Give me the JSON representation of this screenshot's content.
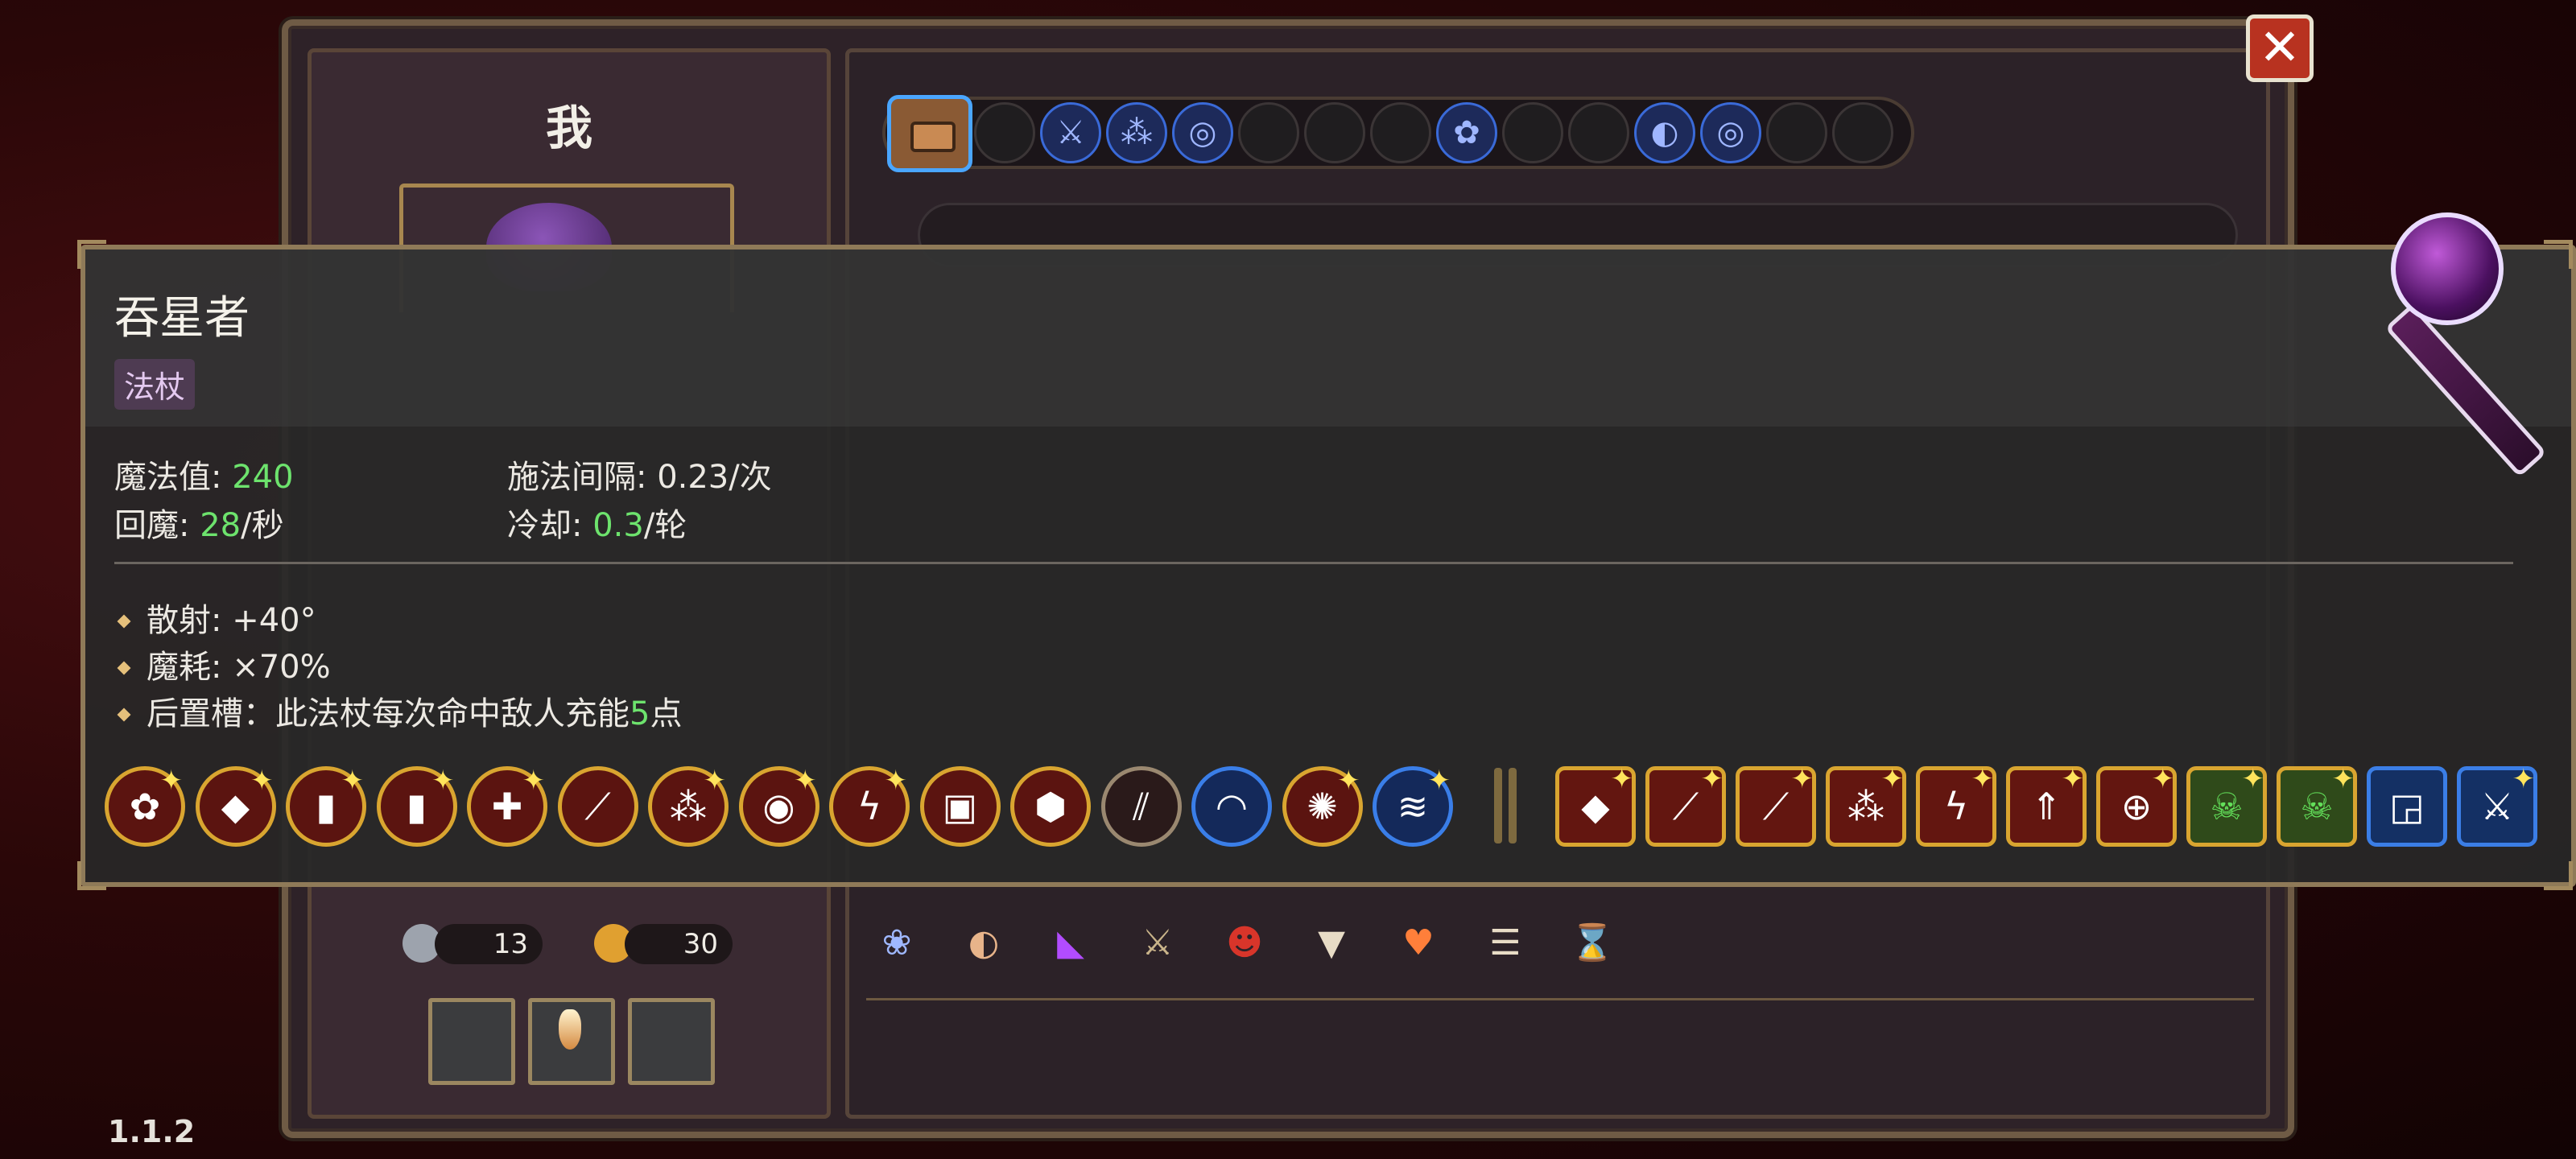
{
  "player": {
    "name": "我"
  },
  "close": {
    "glyph": "✕"
  },
  "inventory": {
    "keys": "13",
    "coins": "30"
  },
  "version": "1.1.2",
  "tooltip": {
    "title": "吞星者",
    "tag": "法杖",
    "stats": {
      "mana_label": "魔法值: ",
      "mana_value": "240",
      "recharge_label": "回魔: ",
      "recharge_value": "28",
      "recharge_unit": "/秒",
      "cast_delay_label": "施法间隔: 0.23/次",
      "cooldown_label": "冷却: ",
      "cooldown_value": "0.3",
      "cooldown_unit": "/轮"
    },
    "properties": {
      "spread": "散射: +40°",
      "mana_cost": "魔耗: ×70%",
      "post_slot_prefix": "后置槽：此法杖每次命中敌人充能",
      "post_slot_value": "5",
      "post_slot_suffix": "点"
    }
  },
  "spells": {
    "round": [
      {
        "icon": "flower-burst-icon",
        "glyph": "✿",
        "spark": true
      },
      {
        "icon": "rock-icon",
        "glyph": "◆",
        "spark": true
      },
      {
        "icon": "battery-icon",
        "glyph": "▮",
        "spark": true
      },
      {
        "icon": "battery-icon",
        "glyph": "▮",
        "spark": true
      },
      {
        "icon": "cross-burst-icon",
        "glyph": "✚",
        "spark": true
      },
      {
        "icon": "claw-icon",
        "glyph": "⟋",
        "spark": false
      },
      {
        "icon": "triple-shot-icon",
        "glyph": "⁂",
        "spark": true
      },
      {
        "icon": "eye-target-icon",
        "glyph": "◉",
        "spark": true
      },
      {
        "icon": "lightning-icon",
        "glyph": "ϟ",
        "spark": true
      },
      {
        "icon": "box-icon",
        "glyph": "▣",
        "spark": false
      },
      {
        "icon": "crystal-icon",
        "glyph": "⬢",
        "spark": false
      },
      {
        "icon": "slash-icon",
        "glyph": "⫽",
        "spark": false
      },
      {
        "icon": "rainbow-icon",
        "glyph": "◠",
        "spark": false
      },
      {
        "icon": "starburst-icon",
        "glyph": "✺",
        "spark": true
      },
      {
        "icon": "storm-icon",
        "glyph": "≋",
        "spark": true
      }
    ],
    "square": [
      {
        "icon": "rock-icon",
        "glyph": "◆",
        "spark": true,
        "style": ""
      },
      {
        "icon": "claw-icon",
        "glyph": "⟋",
        "spark": true,
        "style": ""
      },
      {
        "icon": "claw-icon",
        "glyph": "⟋",
        "spark": true,
        "style": ""
      },
      {
        "icon": "triple-shot-icon",
        "glyph": "⁂",
        "spark": true,
        "style": ""
      },
      {
        "icon": "lightning-icon",
        "glyph": "ϟ",
        "spark": true,
        "style": ""
      },
      {
        "icon": "arrow-up-icon",
        "glyph": "⇑",
        "spark": true,
        "style": ""
      },
      {
        "icon": "crosshair-icon",
        "glyph": "⊕",
        "spark": true,
        "style": ""
      },
      {
        "icon": "skull-icon",
        "glyph": "☠",
        "spark": true,
        "style": "green"
      },
      {
        "icon": "skull-icon",
        "glyph": "☠",
        "spark": true,
        "style": "green"
      },
      {
        "icon": "spiral-icon",
        "glyph": "◲",
        "spark": false,
        "style": "blue"
      },
      {
        "icon": "swords-icon",
        "glyph": "⚔",
        "spark": true,
        "style": "blue"
      }
    ]
  },
  "relics": [
    {
      "icon": "lotus-icon",
      "glyph": "❀",
      "color": "#9fb8ff"
    },
    {
      "icon": "ear-icon",
      "glyph": "◐",
      "color": "#e8b48a"
    },
    {
      "icon": "cape-icon",
      "glyph": "◣",
      "color": "#b24cff"
    },
    {
      "icon": "sword-icon",
      "glyph": "⚔",
      "color": "#c9b48a"
    },
    {
      "icon": "demon-mask-icon",
      "glyph": "☻",
      "color": "#d8352a"
    },
    {
      "icon": "fangs-icon",
      "glyph": "▼",
      "color": "#e8dcc6"
    },
    {
      "icon": "heart-icon",
      "glyph": "♥",
      "color": "#ff7f3a"
    },
    {
      "icon": "ribcage-icon",
      "glyph": "☰",
      "color": "#e8dcc6"
    },
    {
      "icon": "hourglass-icon",
      "glyph": "⌛",
      "color": "#e8b048"
    }
  ],
  "equip_bar": [
    {
      "icon": "empty-slot"
    },
    {
      "icon": "sword-rune-icon",
      "glyph": "⚔"
    },
    {
      "icon": "triple-shot-icon",
      "glyph": "⁂"
    },
    {
      "icon": "vortex-icon",
      "glyph": "◎"
    },
    {
      "icon": "empty-slot"
    },
    {
      "icon": "empty-slot"
    },
    {
      "icon": "empty-slot"
    },
    {
      "icon": "flower-burst-icon",
      "glyph": "✿"
    },
    {
      "icon": "empty-slot"
    },
    {
      "icon": "empty-slot"
    },
    {
      "icon": "swirl-icon",
      "glyph": "◐"
    },
    {
      "icon": "vortex-icon",
      "glyph": "◎"
    },
    {
      "icon": "empty-slot"
    },
    {
      "icon": "empty-slot"
    }
  ]
}
